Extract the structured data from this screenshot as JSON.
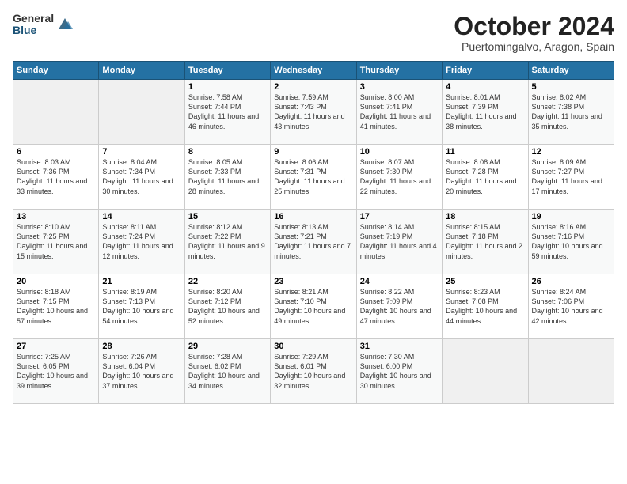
{
  "logo": {
    "general": "General",
    "blue": "Blue"
  },
  "title": "October 2024",
  "subtitle": "Puertomingalvo, Aragon, Spain",
  "headers": [
    "Sunday",
    "Monday",
    "Tuesday",
    "Wednesday",
    "Thursday",
    "Friday",
    "Saturday"
  ],
  "weeks": [
    [
      {
        "day": "",
        "info": ""
      },
      {
        "day": "",
        "info": ""
      },
      {
        "day": "1",
        "info": "Sunrise: 7:58 AM\nSunset: 7:44 PM\nDaylight: 11 hours and 46 minutes."
      },
      {
        "day": "2",
        "info": "Sunrise: 7:59 AM\nSunset: 7:43 PM\nDaylight: 11 hours and 43 minutes."
      },
      {
        "day": "3",
        "info": "Sunrise: 8:00 AM\nSunset: 7:41 PM\nDaylight: 11 hours and 41 minutes."
      },
      {
        "day": "4",
        "info": "Sunrise: 8:01 AM\nSunset: 7:39 PM\nDaylight: 11 hours and 38 minutes."
      },
      {
        "day": "5",
        "info": "Sunrise: 8:02 AM\nSunset: 7:38 PM\nDaylight: 11 hours and 35 minutes."
      }
    ],
    [
      {
        "day": "6",
        "info": "Sunrise: 8:03 AM\nSunset: 7:36 PM\nDaylight: 11 hours and 33 minutes."
      },
      {
        "day": "7",
        "info": "Sunrise: 8:04 AM\nSunset: 7:34 PM\nDaylight: 11 hours and 30 minutes."
      },
      {
        "day": "8",
        "info": "Sunrise: 8:05 AM\nSunset: 7:33 PM\nDaylight: 11 hours and 28 minutes."
      },
      {
        "day": "9",
        "info": "Sunrise: 8:06 AM\nSunset: 7:31 PM\nDaylight: 11 hours and 25 minutes."
      },
      {
        "day": "10",
        "info": "Sunrise: 8:07 AM\nSunset: 7:30 PM\nDaylight: 11 hours and 22 minutes."
      },
      {
        "day": "11",
        "info": "Sunrise: 8:08 AM\nSunset: 7:28 PM\nDaylight: 11 hours and 20 minutes."
      },
      {
        "day": "12",
        "info": "Sunrise: 8:09 AM\nSunset: 7:27 PM\nDaylight: 11 hours and 17 minutes."
      }
    ],
    [
      {
        "day": "13",
        "info": "Sunrise: 8:10 AM\nSunset: 7:25 PM\nDaylight: 11 hours and 15 minutes."
      },
      {
        "day": "14",
        "info": "Sunrise: 8:11 AM\nSunset: 7:24 PM\nDaylight: 11 hours and 12 minutes."
      },
      {
        "day": "15",
        "info": "Sunrise: 8:12 AM\nSunset: 7:22 PM\nDaylight: 11 hours and 9 minutes."
      },
      {
        "day": "16",
        "info": "Sunrise: 8:13 AM\nSunset: 7:21 PM\nDaylight: 11 hours and 7 minutes."
      },
      {
        "day": "17",
        "info": "Sunrise: 8:14 AM\nSunset: 7:19 PM\nDaylight: 11 hours and 4 minutes."
      },
      {
        "day": "18",
        "info": "Sunrise: 8:15 AM\nSunset: 7:18 PM\nDaylight: 11 hours and 2 minutes."
      },
      {
        "day": "19",
        "info": "Sunrise: 8:16 AM\nSunset: 7:16 PM\nDaylight: 10 hours and 59 minutes."
      }
    ],
    [
      {
        "day": "20",
        "info": "Sunrise: 8:18 AM\nSunset: 7:15 PM\nDaylight: 10 hours and 57 minutes."
      },
      {
        "day": "21",
        "info": "Sunrise: 8:19 AM\nSunset: 7:13 PM\nDaylight: 10 hours and 54 minutes."
      },
      {
        "day": "22",
        "info": "Sunrise: 8:20 AM\nSunset: 7:12 PM\nDaylight: 10 hours and 52 minutes."
      },
      {
        "day": "23",
        "info": "Sunrise: 8:21 AM\nSunset: 7:10 PM\nDaylight: 10 hours and 49 minutes."
      },
      {
        "day": "24",
        "info": "Sunrise: 8:22 AM\nSunset: 7:09 PM\nDaylight: 10 hours and 47 minutes."
      },
      {
        "day": "25",
        "info": "Sunrise: 8:23 AM\nSunset: 7:08 PM\nDaylight: 10 hours and 44 minutes."
      },
      {
        "day": "26",
        "info": "Sunrise: 8:24 AM\nSunset: 7:06 PM\nDaylight: 10 hours and 42 minutes."
      }
    ],
    [
      {
        "day": "27",
        "info": "Sunrise: 7:25 AM\nSunset: 6:05 PM\nDaylight: 10 hours and 39 minutes."
      },
      {
        "day": "28",
        "info": "Sunrise: 7:26 AM\nSunset: 6:04 PM\nDaylight: 10 hours and 37 minutes."
      },
      {
        "day": "29",
        "info": "Sunrise: 7:28 AM\nSunset: 6:02 PM\nDaylight: 10 hours and 34 minutes."
      },
      {
        "day": "30",
        "info": "Sunrise: 7:29 AM\nSunset: 6:01 PM\nDaylight: 10 hours and 32 minutes."
      },
      {
        "day": "31",
        "info": "Sunrise: 7:30 AM\nSunset: 6:00 PM\nDaylight: 10 hours and 30 minutes."
      },
      {
        "day": "",
        "info": ""
      },
      {
        "day": "",
        "info": ""
      }
    ]
  ]
}
